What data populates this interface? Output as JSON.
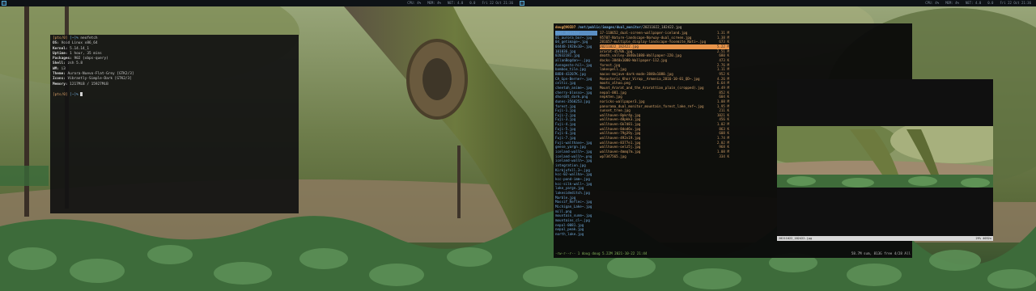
{
  "statusbar": {
    "left": {
      "cpu": "CPU: 4%",
      "mem": "MEM: 4%",
      "net": "NET: 4.0",
      "net2": "0.0",
      "clock": "Fri 22 Oct 21:36"
    },
    "right": {
      "cpu": "CPU: 4%",
      "mem": "MEM: 4%",
      "net": "NET: 4.0",
      "net2": "0.0",
      "clock": "Fri 22 Oct 21:36"
    }
  },
  "terminal": {
    "prompt_user": "[pts/0]",
    "prompt_path": "[~]%",
    "command": "neofetch",
    "info": [
      {
        "key": "OS:",
        "value": "Void Linux x86_64"
      },
      {
        "key": "Kernel:",
        "value": "5.14.14_1"
      },
      {
        "key": "Uptime:",
        "value": "1 hour, 35 mins"
      },
      {
        "key": "Packages:",
        "value": "902 (xbps-query)"
      },
      {
        "key": "Shell:",
        "value": "zsh 5.8"
      },
      {
        "key": "WM:",
        "value": "i3"
      },
      {
        "key": "Theme:",
        "value": "Aurora-Nuevo-Flat-Grey [GTK2/3]"
      },
      {
        "key": "Icons:",
        "value": "Vibrantly-Simple-Dark [GTK2/3]"
      },
      {
        "key": "Memory:",
        "value": "1217MiB / 15927MiB"
      }
    ],
    "prompt2_user": "[pts/0]",
    "prompt2_path": "[~]%"
  },
  "file_manager": {
    "header_user": "doug@VOID7",
    "header_path": "/mnt/public/images/dual_monitor/",
    "header_file": "20211022_182422.jpg",
    "left_column": [
      "dual_monitor",
      "01_aurora_bor~.jpg",
      "04_getimage~.jpg",
      "04448-1920x10~.jpg",
      "101036.jpg",
      "02032181.jpg",
      "allanBogdan~-.jpg",
      "Avengeste-hil~.jpg",
      "bamboo_tile.jpg",
      "B8D8-43207K.jpg",
      "CA_Gpn-Berner~.jpg",
      "celtic.jpg",
      "cheetah_anime~.jpg",
      "cherry-blosso~.jpg",
      "dhorddt_dark.png",
      "dunes-3560253.jpg",
      "forest.jpg",
      "Fuji-1.jpg",
      "Fuji-2.jpg",
      "Fuji-3.jpg",
      "Fuji-4.jpg",
      "Fuji-5.jpg",
      "Fuji-6.jpg",
      "Fuji-7.jpg",
      "Fuji-walthave~.jpg",
      "geese_yargn.jpg",
      "iceland-wallh~.jpg",
      "iceland-wallh~.png",
      "iceland-wallh~.jpg",
      "integration.jpg",
      "Kirkjufell.3~.jpg",
      "kcc-02-wallha~.jpg",
      "kcc-pond-imm~.jpg",
      "kcc-silk-wall~.jpg",
      "lake_yargn.jpg",
      "lakesideditch.jpg",
      "Marble.jpg",
      "Massif_Reflec~.jpg",
      "Michigan_Lake~.jpg",
      "mill.png",
      "mountain_sunm~.jpg",
      "mountains_cl~.jpg",
      "nepal-0081.jpg",
      "nepal_peak.jpg",
      "north_lake.jpg"
    ],
    "right_column": [
      {
        "name": "17-118652_dual-screen-wallpaper-iceland.jpg",
        "size": "1.31 M"
      },
      {
        "name": "95707-Nature-landscape-Norway-dual_screen.jpg",
        "size": "1.38 M"
      },
      {
        "name": "281657-multiple_display-landscape-Yosemite_Nati~.jpg",
        "size": "673 K"
      },
      {
        "name": "20211022_182422.jpg",
        "size": "5.22 M",
        "selected": true
      },
      {
        "name": "ararat-4570b.jpg",
        "size": "2.51 M"
      },
      {
        "name": "death_valley-3840x1080-Wallpaper-220.jpg",
        "size": "680 K"
      },
      {
        "name": "docks-3840x1080-Wallpaper-112.jpg",
        "size": "473 K"
      },
      {
        "name": "forest.jpg",
        "size": "2.76 M"
      },
      {
        "name": "lakespell.jpg",
        "size": "1.11 M"
      },
      {
        "name": "macos-mojave-dark-mode-3840x1080.jpg",
        "size": "952 K"
      },
      {
        "name": "Monasteric_Khor_Virap__Armenia_2016-10-01_QD~.jpg",
        "size": "4.26 M"
      },
      {
        "name": "moots_alhoo.png",
        "size": "6.64 M"
      },
      {
        "name": "Mount_Ararat_and_the_Ararattian_plain_(cropped).jpg",
        "size": "4.49 M"
      },
      {
        "name": "nepal-001.jpg",
        "size": "852 K"
      },
      {
        "name": "nepkten.jpg",
        "size": "604 K"
      },
      {
        "name": "noricks-wallpaper3.jpg",
        "size": "1.08 M"
      },
      {
        "name": "panorama_dual_monitor_mountain_forest_lake_ref~.jpg",
        "size": "1.95 M"
      },
      {
        "name": "sunset_tree.jpg",
        "size": "211 K"
      },
      {
        "name": "wallhaven-8pkr4p.jpg",
        "size": "1021 K"
      },
      {
        "name": "wallhaven-48pkk3.jpg",
        "size": "456 K"
      },
      {
        "name": "wallhaven-6k7d81.jpg",
        "size": "1.02 M"
      },
      {
        "name": "wallhaven-8dod6v.jpg",
        "size": "863 K"
      },
      {
        "name": "wallhaven-79g39y.jpg",
        "size": "608 K"
      },
      {
        "name": "wallhaven-492v19.jpg",
        "size": "1.74 M"
      },
      {
        "name": "wallhaven-8377e1.jpg",
        "size": "2.02 M"
      },
      {
        "name": "wallhaven-oelz5j.jpg",
        "size": "968 K"
      },
      {
        "name": "wallhaven-4mmq7m.jpg",
        "size": "1.08 M"
      },
      {
        "name": "wp7347565.jpg",
        "size": "334 K"
      }
    ],
    "footer_left": "-rw-r--r-- 1 doug doug 5.22M 2021-10-22 21:44",
    "footer_right": "58.7M sum, 813G free  4/28  All"
  },
  "viewer": {
    "status_left": "20211022_182422.jpg",
    "status_right": "29%  4032x"
  },
  "colors": {
    "accent_orange": "#e8944a",
    "accent_blue": "#5a8fc4",
    "terminal_bg": "#121212"
  }
}
